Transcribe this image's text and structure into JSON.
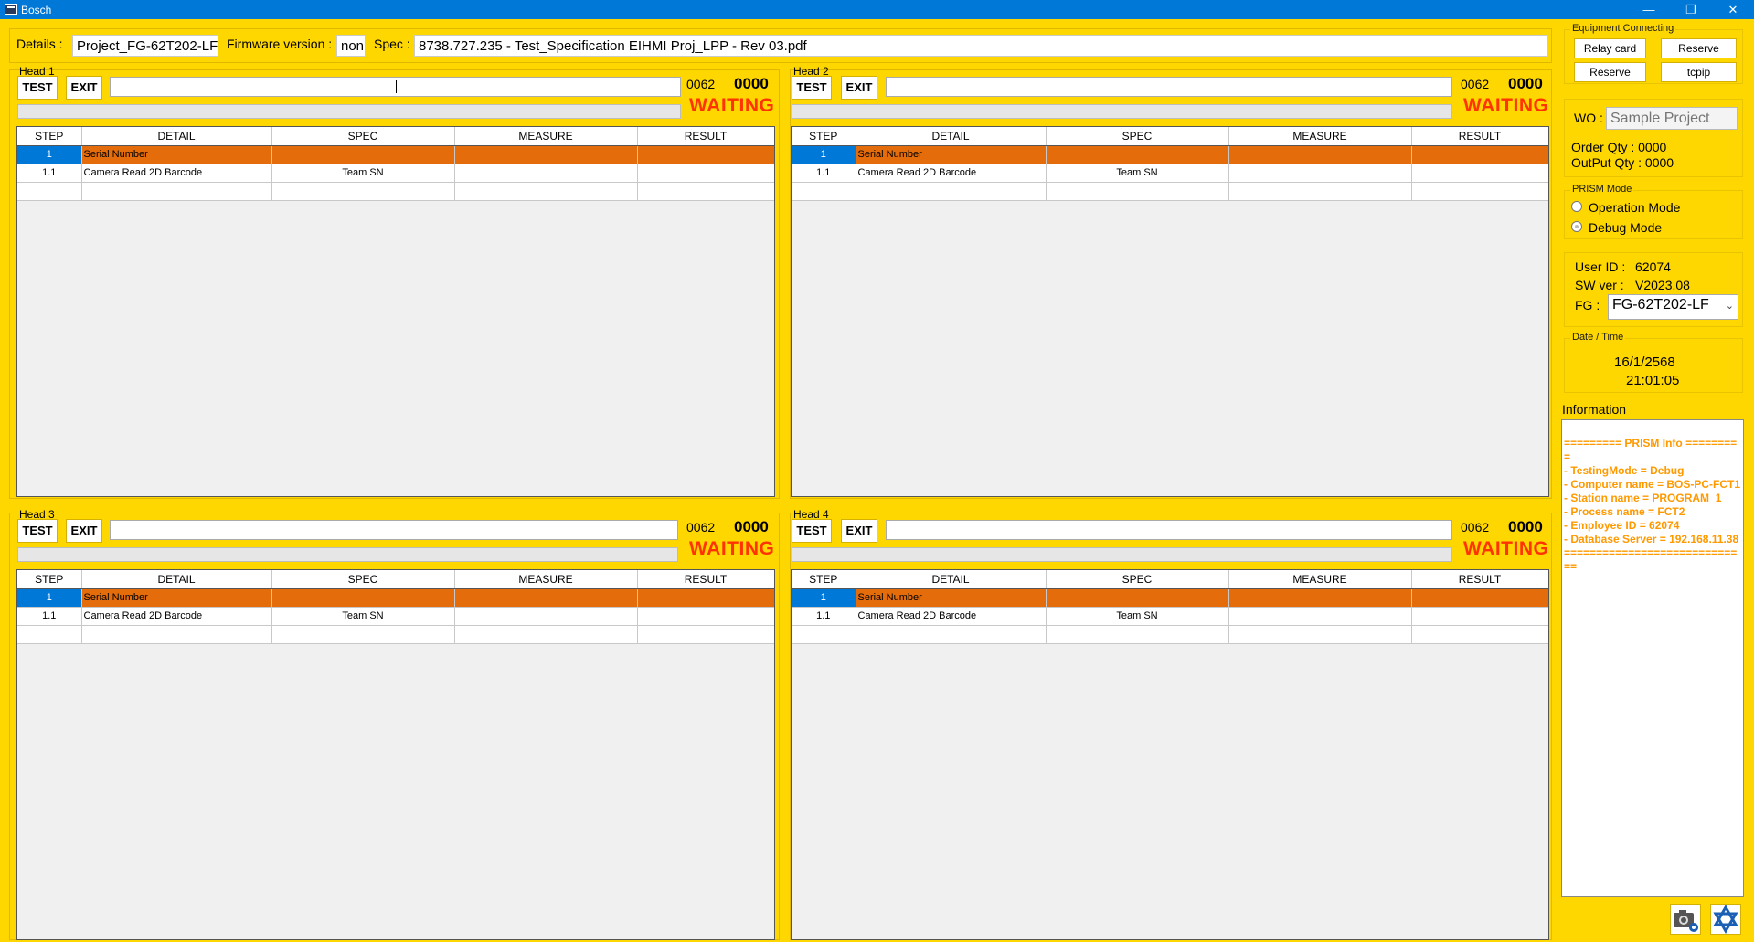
{
  "window": {
    "title": "Bosch",
    "minimize": "—",
    "maximize": "❐",
    "close": "✕"
  },
  "details": {
    "details_label": "Details :",
    "project": "Project_FG-62T202-LF",
    "firmware_label": "Firmware version :",
    "firmware": "non",
    "spec_label": "Spec :",
    "spec": "8738.727.235 - Test_Specification EIHMI Proj_LPP - Rev 03.pdf"
  },
  "columns": [
    "STEP",
    "DETAIL",
    "SPEC",
    "MEASURE",
    "RESULT"
  ],
  "heads": [
    {
      "title": "Head 1",
      "test_label": "TEST",
      "exit_label": "EXIT",
      "count_small": "0062",
      "count_big": "0000",
      "status": "WAITING",
      "rows": [
        {
          "step": "1",
          "detail": "Serial Number",
          "spec": "",
          "measure": "",
          "result": ""
        },
        {
          "step": "1.1",
          "detail": "Camera Read 2D Barcode",
          "spec": "Team SN",
          "measure": "",
          "result": ""
        },
        {
          "step": "",
          "detail": "",
          "spec": "",
          "measure": "",
          "result": ""
        }
      ]
    },
    {
      "title": "Head 2",
      "test_label": "TEST",
      "exit_label": "EXIT",
      "count_small": "0062",
      "count_big": "0000",
      "status": "WAITING",
      "rows": [
        {
          "step": "1",
          "detail": "Serial Number",
          "spec": "",
          "measure": "",
          "result": ""
        },
        {
          "step": "1.1",
          "detail": "Camera Read 2D Barcode",
          "spec": "Team SN",
          "measure": "",
          "result": ""
        },
        {
          "step": "",
          "detail": "",
          "spec": "",
          "measure": "",
          "result": ""
        }
      ]
    },
    {
      "title": "Head 3",
      "test_label": "TEST",
      "exit_label": "EXIT",
      "count_small": "0062",
      "count_big": "0000",
      "status": "WAITING",
      "rows": [
        {
          "step": "1",
          "detail": "Serial Number",
          "spec": "",
          "measure": "",
          "result": ""
        },
        {
          "step": "1.1",
          "detail": "Camera Read 2D Barcode",
          "spec": "Team SN",
          "measure": "",
          "result": ""
        },
        {
          "step": "",
          "detail": "",
          "spec": "",
          "measure": "",
          "result": ""
        }
      ]
    },
    {
      "title": "Head 4",
      "test_label": "TEST",
      "exit_label": "EXIT",
      "count_small": "0062",
      "count_big": "0000",
      "status": "WAITING",
      "rows": [
        {
          "step": "1",
          "detail": "Serial Number",
          "spec": "",
          "measure": "",
          "result": ""
        },
        {
          "step": "1.1",
          "detail": "Camera Read 2D Barcode",
          "spec": "Team SN",
          "measure": "",
          "result": ""
        },
        {
          "step": "",
          "detail": "",
          "spec": "",
          "measure": "",
          "result": ""
        }
      ]
    }
  ],
  "equipment": {
    "title": "Equipment Connecting",
    "relay_card": "Relay card",
    "reserve_1": "Reserve",
    "reserve_2": "Reserve",
    "tcpip": "tcpip"
  },
  "wo": {
    "wo_label": "WO :",
    "wo_placeholder": "Sample Project",
    "order_qty": "Order Qty : 0000",
    "output_qty": "OutPut Qty : 0000"
  },
  "prism_mode": {
    "title": "PRISM Mode",
    "operation": "Operation Mode",
    "debug": "Debug Mode"
  },
  "user": {
    "user_id_label": "User ID :",
    "user_id": "62074",
    "sw_ver_label": "SW ver :",
    "sw_ver": "V2023.08",
    "fg_label": "FG :",
    "fg": "FG-62T202-LF"
  },
  "datetime": {
    "title": "Date / Time",
    "date": "16/1/2568",
    "time": "21:01:05"
  },
  "information": {
    "title": "Information",
    "lines": [
      "========= PRISM Info =========",
      "- TestingMode = Debug",
      "- Computer name = BOS-PC-FCT1",
      "- Station name = PROGRAM_1",
      "- Process name = FCT2",
      "- Employee ID = 62074",
      "- Database Server = 192.168.11.38",
      "============================="
    ]
  },
  "icons": {
    "camera_settings": "camera-settings-icon",
    "star_settings": "star-icon"
  },
  "colors": {
    "background": "#FFD700",
    "status": "#FF3300",
    "selected_row": "#E46C0A",
    "selected_step": "#0078D7",
    "info_text": "#FF9900"
  }
}
